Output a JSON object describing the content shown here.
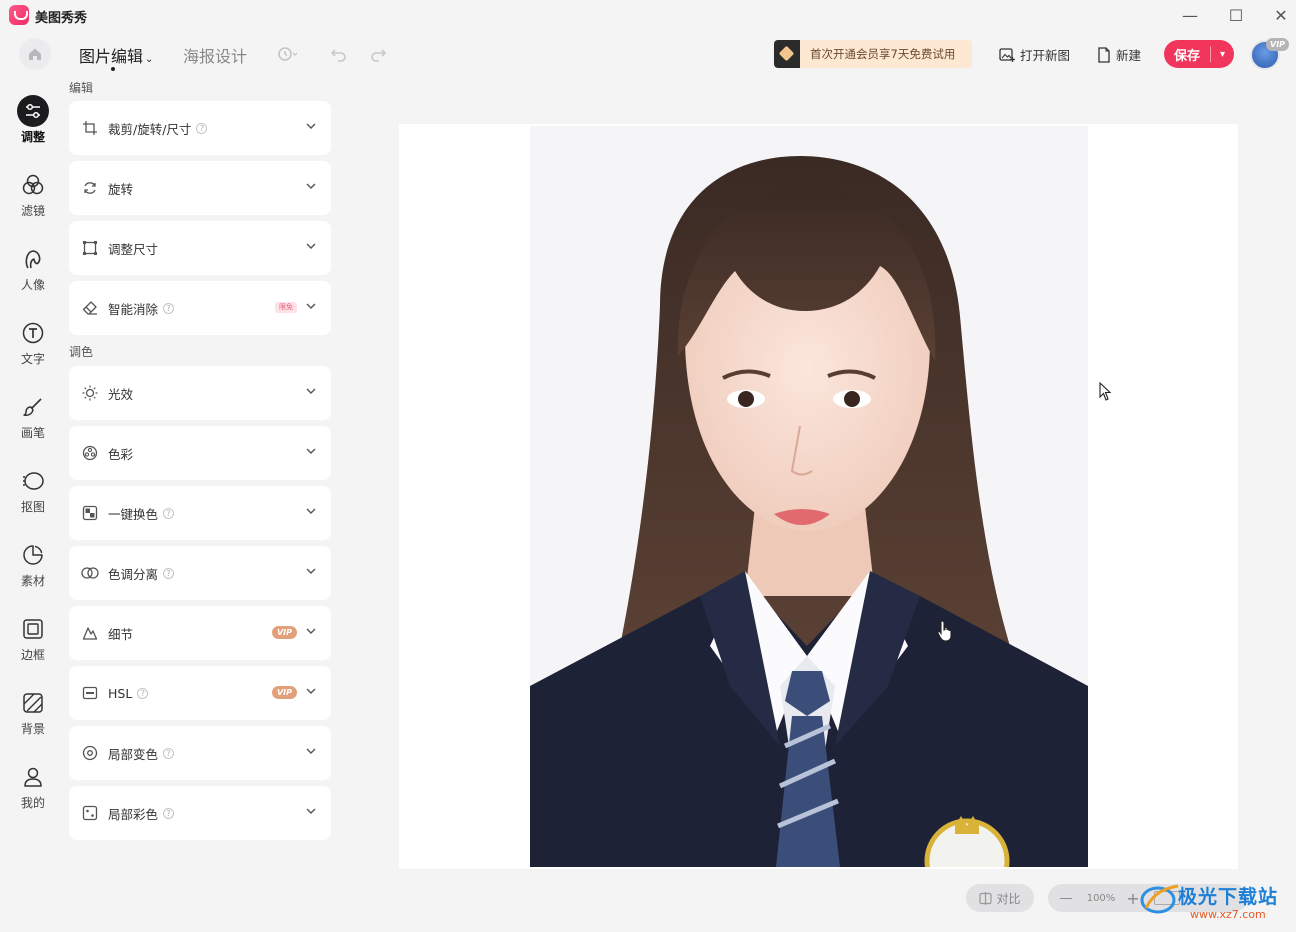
{
  "app": {
    "title": "美图秀秀"
  },
  "window": {
    "minimize": "—",
    "maximize": "☐",
    "close": "✕"
  },
  "toolbar": {
    "tabs": [
      {
        "label": "图片编辑",
        "active": true
      },
      {
        "label": "海报设计",
        "active": false
      }
    ],
    "promo": "首次开通会员享7天免费试用",
    "open_label": "打开新图",
    "new_label": "新建",
    "save_label": "保存",
    "vip_label": "VIP"
  },
  "rail": [
    {
      "label": "调整",
      "icon": "adjust-icon",
      "active": true
    },
    {
      "label": "滤镜",
      "icon": "filter-icon"
    },
    {
      "label": "人像",
      "icon": "portrait-icon"
    },
    {
      "label": "文字",
      "icon": "text-icon"
    },
    {
      "label": "画笔",
      "icon": "brush-icon"
    },
    {
      "label": "抠图",
      "icon": "cutout-icon"
    },
    {
      "label": "素材",
      "icon": "sticker-icon"
    },
    {
      "label": "边框",
      "icon": "frame-icon"
    },
    {
      "label": "背景",
      "icon": "background-icon"
    },
    {
      "label": "我的",
      "icon": "user-icon"
    }
  ],
  "panel": {
    "edit_title": "编辑",
    "color_title": "调色",
    "edit_items": [
      {
        "label": "裁剪/旋转/尺寸",
        "icon": "crop-icon",
        "help": true
      },
      {
        "label": "旋转",
        "icon": "rotate-icon"
      },
      {
        "label": "调整尺寸",
        "icon": "resize-icon"
      },
      {
        "label": "智能消除",
        "icon": "eraser-icon",
        "help": true,
        "tag": "限免"
      }
    ],
    "color_items": [
      {
        "label": "光效",
        "icon": "light-icon"
      },
      {
        "label": "色彩",
        "icon": "color-icon"
      },
      {
        "label": "一键换色",
        "icon": "recolor-icon",
        "help": true
      },
      {
        "label": "色调分离",
        "icon": "tone-split-icon",
        "help": true
      },
      {
        "label": "细节",
        "icon": "detail-icon",
        "vip": "VIP"
      },
      {
        "label": "HSL",
        "icon": "hsl-icon",
        "help": true,
        "vip": "VIP"
      },
      {
        "label": "局部变色",
        "icon": "local-color-icon",
        "help": true
      },
      {
        "label": "局部彩色",
        "icon": "local-colorful-icon",
        "help": true
      }
    ]
  },
  "bottom": {
    "compare_label": "对比",
    "zoom": "100%",
    "minus": "—",
    "plus": "+"
  },
  "watermark": {
    "text": "极光下载站",
    "url": "www.xz7.com"
  }
}
